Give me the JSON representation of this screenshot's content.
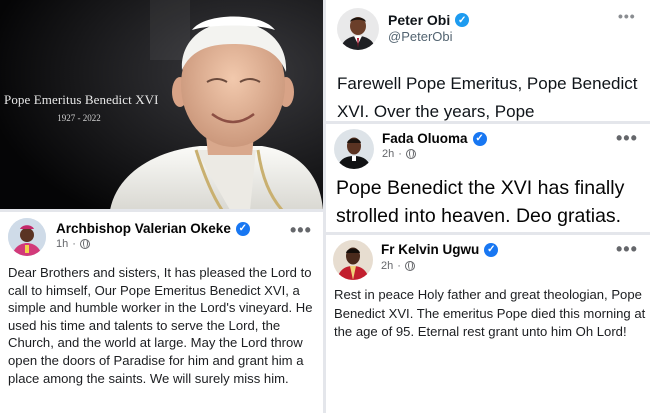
{
  "photo": {
    "caption_name": "Pope Emeritus Benedict XVI",
    "caption_years": "1927 - 2022"
  },
  "post_okeke": {
    "author": "Archbishop Valerian Okeke",
    "time": "1h",
    "more": "•••",
    "body": "Dear Brothers and sisters, It has pleased the Lord to call to himself, Our Pope Emeritus Benedict XVI, a simple and humble worker in the Lord's vineyard. He used his time and talents to serve the Lord, the Church, and the world at large. May the Lord throw open the doors of Paradise for him and grant him a place among the saints. We will surely miss him."
  },
  "post_obi": {
    "author": "Peter Obi",
    "handle": "@PeterObi",
    "more": "•••",
    "body": "Farewell Pope Emeritus, Pope Benedict XVI. Over the years, Pope"
  },
  "post_fada": {
    "author": "Fada Oluoma",
    "time": "2h",
    "more": "•••",
    "body": "Pope Benedict the XVI has finally strolled into heaven. Deo gratias."
  },
  "post_ugwu": {
    "author": "Fr Kelvin Ugwu",
    "time": "2h",
    "more": "•••",
    "body": "Rest in peace Holy father and great theologian, Pope Benedict XVI. The emeritus Pope died this morning at the age of 95. Eternal rest grant unto him Oh Lord!"
  },
  "colors": {
    "verified": "#1877f2",
    "meta_text": "#65676b",
    "photo_bg": "#0b0b0d"
  }
}
